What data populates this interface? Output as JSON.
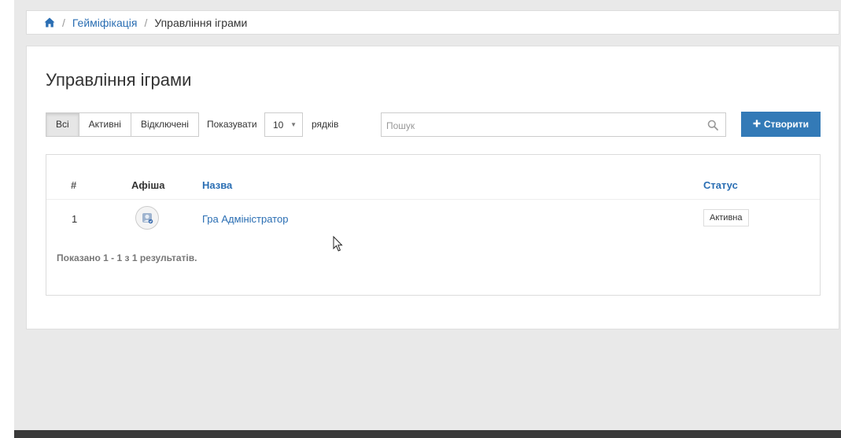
{
  "breadcrumb": {
    "home_icon": "home-icon",
    "sep1": "/",
    "link": "Гейміфікація",
    "sep2": "/",
    "current": "Управління іграми"
  },
  "page": {
    "title": "Управління іграми"
  },
  "filters": {
    "all": "Всі",
    "active": "Активні",
    "disabled": "Відключені",
    "selected": "all"
  },
  "pagination": {
    "show_label": "Показувати",
    "rows_value": "10",
    "rows_label": "рядків"
  },
  "search": {
    "placeholder": "Пошук",
    "value": ""
  },
  "create_button": {
    "label": "Створити"
  },
  "table": {
    "columns": {
      "number": "#",
      "poster": "Афіша",
      "name": "Назва",
      "status": "Статус"
    },
    "rows": [
      {
        "number": "1",
        "name": "Гра Адміністратор",
        "status": "Активна"
      }
    ],
    "summary": "Показано 1 - 1 з 1 результатів."
  },
  "colors": {
    "primary": "#337ab7",
    "link": "#2a6eb3",
    "page_bg": "#e9e9e9",
    "footer": "#3a3a3a"
  }
}
